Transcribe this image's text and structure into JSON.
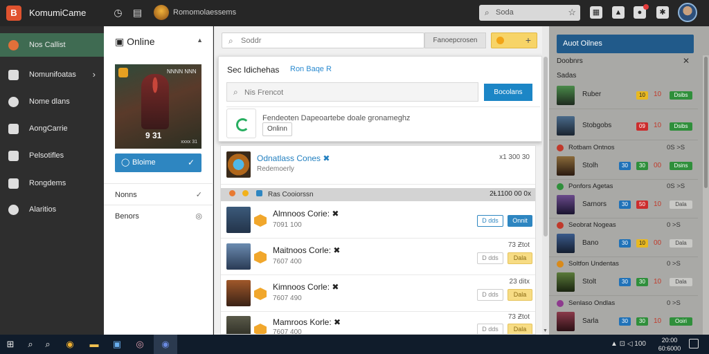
{
  "app": {
    "title": "KomumiCame",
    "logo": "B",
    "user": "Romomolaessems"
  },
  "topbar": {
    "search_text": "Soda",
    "search_icon": "search-icon",
    "star_icon": "star-icon"
  },
  "sidebar": {
    "items": [
      {
        "label": "Nos Callist",
        "icon": "home-icon",
        "active": true
      },
      {
        "label": "Nomunifoatas",
        "icon": "grid-icon",
        "chevron": "›"
      },
      {
        "label": "Nome dlans",
        "icon": "disc-icon"
      },
      {
        "label": "AongCarrie",
        "icon": "gamepad-icon"
      },
      {
        "label": "Pelsotifles",
        "icon": "upload-icon"
      },
      {
        "label": "Rongdems",
        "icon": "list-icon"
      },
      {
        "label": "Alaritios",
        "icon": "alarm-icon"
      }
    ]
  },
  "panel2": {
    "title": "Online",
    "art_caption": "9 31",
    "art_tag": "NNNN NNN",
    "art_small": "xxxx 31",
    "button_label": "Bloime",
    "rows": [
      {
        "label": "Nonns",
        "mark": "✓"
      },
      {
        "label": "Benors",
        "mark": "◎"
      }
    ]
  },
  "main": {
    "search_placeholder": "Soddr",
    "sort_label": "Fanoepcrosen",
    "coin_plus": "+",
    "popup": {
      "title": "Sec Idichehas",
      "link": "Ron Baqe R",
      "input_placeholder": "Nis Frencot",
      "button": "Bocolans",
      "desc": "Fendeoten Dapeoartebe doale gronameghz",
      "tag": "Onlinn"
    },
    "featured": {
      "title": "Odnatlass Cones ✖",
      "sub": "Redemoerly",
      "meta": "x1  300 30"
    },
    "section": {
      "label": "Ras Cooiorssn",
      "right": "2Ɫ1100 00 0x"
    },
    "rows": [
      {
        "title": "Almnoos Corie: ✖",
        "sub": "7091 100",
        "meta": "",
        "btn1": "D dds",
        "btn2": "Onnit",
        "style": "blue"
      },
      {
        "title": "Maitnoos Corle: ✖",
        "sub": "7607 400",
        "meta": "73 Ƶtot",
        "btn1": "D dds",
        "btn2": "Dala",
        "style": "yellow"
      },
      {
        "title": "Kimnoos Corle: ✖",
        "sub": "7607 490",
        "meta": "23 ditx",
        "btn1": "D dds",
        "btn2": "Dala",
        "style": "yellow"
      },
      {
        "title": "Mamroos Korle: ✖",
        "sub": "7607 400",
        "meta": "73 Ƶtot",
        "btn1": "D dds",
        "btn2": "Dala",
        "style": "yellow"
      }
    ]
  },
  "right": {
    "header": "Auot Oilnes",
    "subtitle": "Doobnrs",
    "close": "✕",
    "section": "Sadas",
    "rows": [
      {
        "name": "Ruber",
        "pill1": "",
        "pill2": "10",
        "num": "10",
        "btn": "Dsibs",
        "btnStyle": "green",
        "p2style": "Y"
      },
      {
        "name": "Stobgobs",
        "pill1": "",
        "pill2": "09",
        "num": "10",
        "btn": "Dsibs",
        "btnStyle": "green",
        "p2style": "R"
      },
      {
        "name": "Stolh",
        "pill1": "30",
        "pill2": "30",
        "num": "00",
        "btn": "Dsins",
        "btnStyle": "green",
        "p2style": "G"
      },
      {
        "name": "Sarnors",
        "pill1": "30",
        "pill2": "50",
        "num": "10",
        "btn": "Dala",
        "btnStyle": "light",
        "p2style": "R"
      },
      {
        "name": "Bano",
        "pill1": "30",
        "pill2": "10",
        "num": "00",
        "btn": "Dala",
        "btnStyle": "light",
        "p2style": "Y"
      },
      {
        "name": "Stolt",
        "pill1": "30",
        "pill2": "30",
        "num": "10",
        "btn": "Dala",
        "btnStyle": "light",
        "p2style": "G"
      },
      {
        "name": "Sarla",
        "pill1": "30",
        "pill2": "30",
        "num": "10",
        "btn": "Ooiri",
        "btnStyle": "green",
        "p2style": "G"
      }
    ],
    "cats": [
      {
        "name": "Rotbam Ontnos",
        "right": "0S  >S",
        "color": "#c0392b"
      },
      {
        "name": "Ponfors Agetas",
        "right": "0S  >S",
        "color": "#2f8f3b"
      },
      {
        "name": "Seobrat Nogeas",
        "right": "0  >S",
        "color": "#c0392b"
      },
      {
        "name": "Soltfon Undentas",
        "right": "0  >S",
        "color": "#d98a1a"
      },
      {
        "name": "Senlaso Ondlas",
        "right": "0  >S",
        "color": "#8e3a8e"
      }
    ]
  },
  "taskbar": {
    "time": "20:00",
    "date": "60:6000",
    "tray": "▲  ⊡ ◁ 100"
  }
}
